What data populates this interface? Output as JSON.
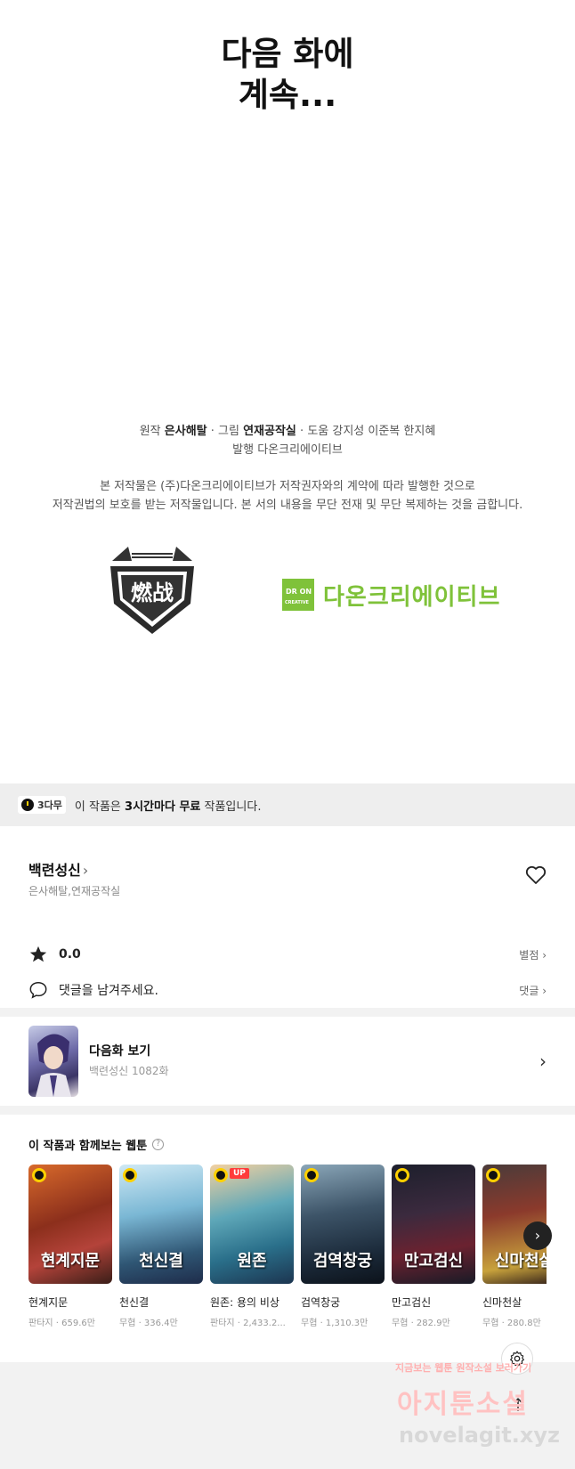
{
  "episode_end": {
    "line1": "다음 화에",
    "line2": "계속..."
  },
  "credits": {
    "original_label": "원작",
    "original": "은사해탈",
    "art_label": "그림",
    "art": "연재공작실",
    "assist_label": "도움",
    "assist": "강지성 이준복 한지혜",
    "publisher_label": "발행",
    "publisher": "다온크리에이티브"
  },
  "copyright": {
    "line1": "본 저작물은 (주)다온크리에이티브가 저작권자와의 계약에 따라 발행한 것으로",
    "line2": "저작권법의 보호를 받는 저작물입니다. 본 서의 내용을 무단 전재 및 무단 복제하는 것을 금합니다."
  },
  "logos": {
    "left_text": "燃战",
    "right_box_top": "DR ON",
    "right_box_bottom": "CREATIVE",
    "right_word": "다온크리에이티브"
  },
  "free_bar": {
    "badge": "3다무",
    "pre": "이 작품은",
    "bold": "3시간마다 무료",
    "post": "작품입니다."
  },
  "work": {
    "title": "백련성신",
    "title_chevron": "›",
    "authors": "은사해탈,연재공작실",
    "rating": "0.0",
    "rating_link": "별점 ›",
    "comment_placeholder": "댓글을 남겨주세요.",
    "comment_link": "댓글 ›"
  },
  "next_episode": {
    "title": "다음화 보기",
    "subtitle": "백련성신 1082화",
    "chevron": "›"
  },
  "recommendations": {
    "title": "이 작품과 함께보는 웹툰",
    "help": "?",
    "items": [
      {
        "name": "현계지문",
        "meta": "판타지 · 659.6만",
        "cover": "현계지문",
        "up": ""
      },
      {
        "name": "천신결",
        "meta": "무협 · 336.4만",
        "cover": "천신결",
        "up": ""
      },
      {
        "name": "원존: 용의 비상",
        "meta": "판타지 · 2,433.2...",
        "cover": "원존",
        "up": "UP"
      },
      {
        "name": "검역창궁",
        "meta": "무협 · 1,310.3만",
        "cover": "검역창궁",
        "up": ""
      },
      {
        "name": "만고검신",
        "meta": "무협 · 282.9만",
        "cover": "만고검신",
        "up": ""
      },
      {
        "name": "신마천살",
        "meta": "무협 · 280.8만",
        "cover": "신마천살",
        "up": ""
      }
    ],
    "scroll_next": "›"
  },
  "float": {
    "top_arrow": "↑"
  },
  "watermark": {
    "line1": "지금보는 웹툰 원작소설 보러가기",
    "line2": "아지툰소설",
    "line3": "novelagit.xyz"
  },
  "colors": {
    "accent_green": "#7fc23a",
    "badge_yellow": "#ffd000",
    "up_red": "#ff3b3b"
  }
}
